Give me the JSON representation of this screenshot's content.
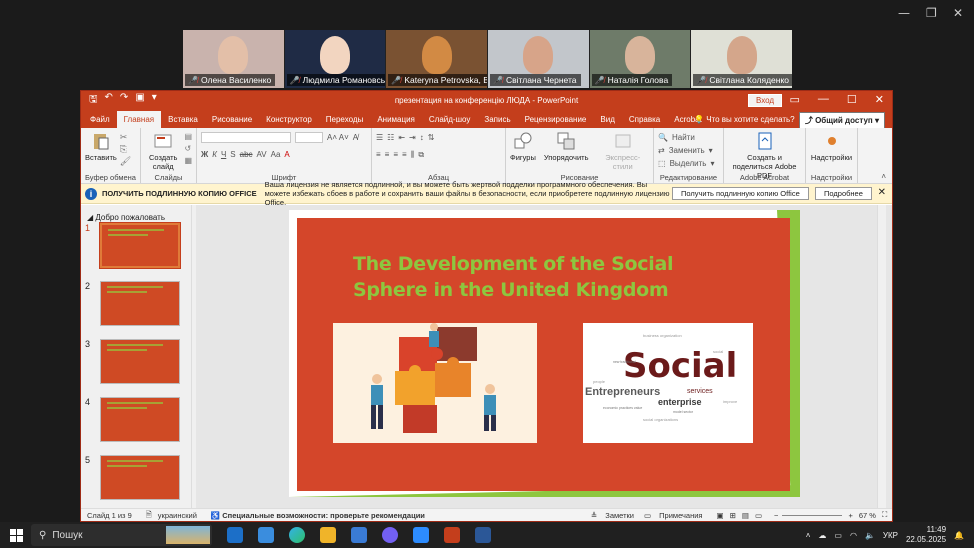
{
  "participants": [
    {
      "name": "Олена Василенко",
      "bg": "#c9b3ad",
      "face": "#e3bfa8"
    },
    {
      "name": "Людмила Романовська",
      "bg": "#1f2b45",
      "face": "#f2d5c0"
    },
    {
      "name": "Kateryna Petrovska, BS...",
      "bg": "#7a5232",
      "face": "#d28a44"
    },
    {
      "name": "Світлана Чернета",
      "bg": "#c2c6cb",
      "face": "#d7a489"
    },
    {
      "name": "Наталія Голова",
      "bg": "#6e7b69",
      "face": "#d8b49b"
    },
    {
      "name": "Світлана Коляденко",
      "bg": "#dfe0d6",
      "face": "#d4a68b"
    }
  ],
  "window": {
    "title": "презентация на конференцію ЛЮДА  -  PowerPoint",
    "login_button": "Вход"
  },
  "tabs": [
    "Файл",
    "Главная",
    "Вставка",
    "Рисование",
    "Конструктор",
    "Переходы",
    "Анимация",
    "Слайд-шоу",
    "Запись",
    "Рецензирование",
    "Вид",
    "Справка",
    "Acrobat"
  ],
  "active_tab": "Главная",
  "tell_me": "Что вы хотите сделать?",
  "share_button": "Общий доступ",
  "ribbon": {
    "clipboard": {
      "paste": "Вставить",
      "label": "Буфер обмена"
    },
    "slides": {
      "new_slide": "Создать слайд",
      "label": "Слайды"
    },
    "font": {
      "label": "Шрифт",
      "bold": "Ж",
      "italic": "К",
      "underline": "Ч",
      "shadow": "S",
      "strike": "abc"
    },
    "paragraph": {
      "label": "Абзац"
    },
    "drawing": {
      "shapes": "Фигуры",
      "arrange": "Упорядочить",
      "quick_styles": "Экспресс-стили",
      "label": "Рисование"
    },
    "editing": {
      "find": "Найти",
      "replace": "Заменить",
      "select": "Выделить",
      "label": "Редактирование"
    },
    "acrobat": {
      "create_pdf": "Создать и поделиться Adobe PDF",
      "label": "Adobe Acrobat"
    },
    "addins": {
      "button": "Надстройки",
      "label": "Надстройки"
    }
  },
  "notice": {
    "title": "ПОЛУЧИТЬ ПОДЛИННУЮ КОПИЮ OFFICE",
    "message": "Ваша лицензия не является подлинной, и вы можете быть жертвой подделки программного обеспечения. Вы можете избежать сбоев в работе и сохранить ваши файлы в безопасности, если приобретете подлинную лицензию Office.",
    "get_button": "Получить подлинную копию Office",
    "more_button": "Подробнее"
  },
  "thumbnails": {
    "section": "Добро пожаловать",
    "slides": [
      "1",
      "2",
      "3",
      "4",
      "5"
    ]
  },
  "slide": {
    "title_line1": "The Development of the Social",
    "title_line2": "Sphere in the United Kingdom",
    "word_main": "Social",
    "word_sub1": "Entrepreneurs",
    "word_sub2": "enterprise",
    "word_sub3": "services"
  },
  "statusbar": {
    "slide_of": "Слайд 1 из 9",
    "language": "украинский",
    "accessibility": "Специальные возможности: проверьте рекомендации",
    "notes": "Заметки",
    "comments": "Примечания",
    "zoom": "67 %"
  },
  "taskbar": {
    "search": "Пошук",
    "lang": "УКР",
    "time": "11:49",
    "date": "22.05.2025"
  }
}
